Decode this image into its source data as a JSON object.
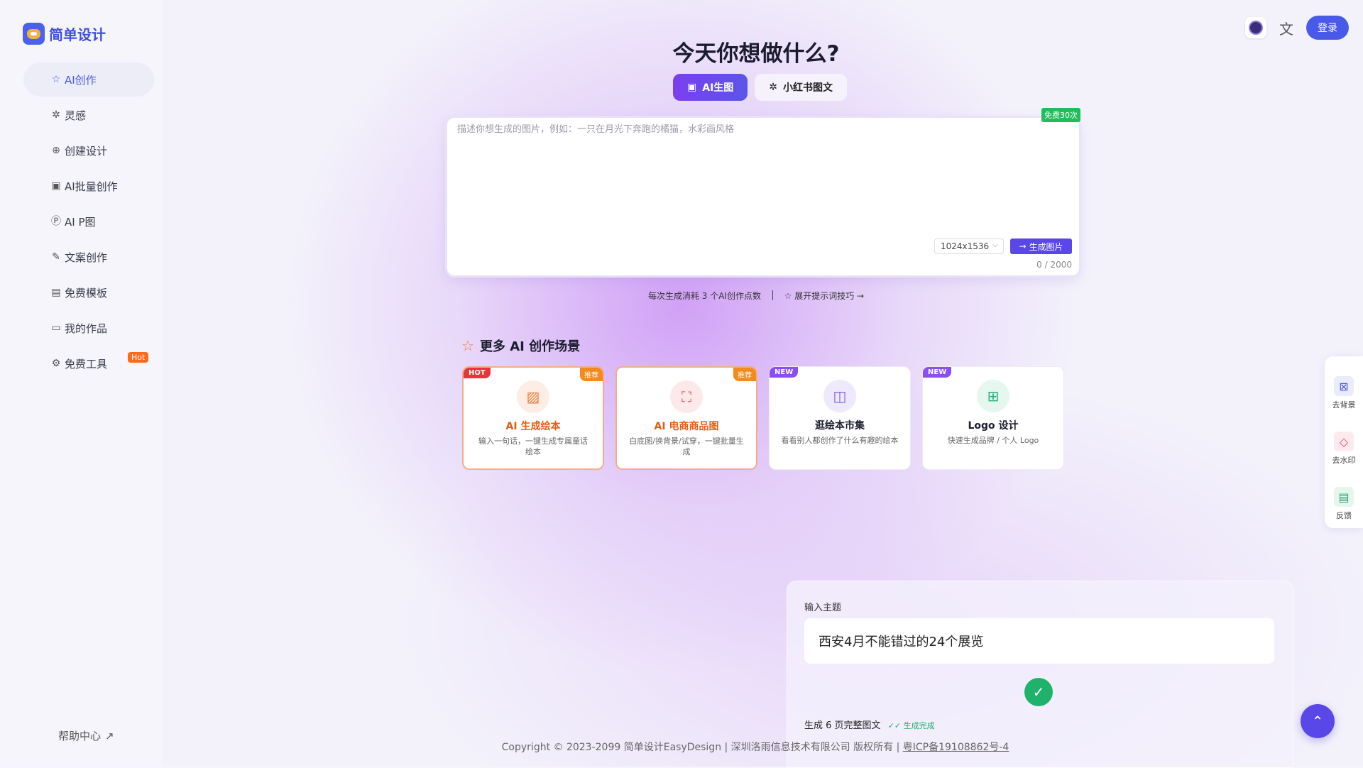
{
  "app": {
    "logo_text": "简单设计"
  },
  "sidebar": {
    "items": [
      {
        "label": "AI创作",
        "icon": "star-icon",
        "glyph": "☆"
      },
      {
        "label": "灵感",
        "icon": "sparkle-icon",
        "glyph": "✲"
      },
      {
        "label": "创建设计",
        "icon": "plus-circle-icon",
        "glyph": "⊕"
      },
      {
        "label": "AI批量创作",
        "icon": "image-icon",
        "glyph": "▣"
      },
      {
        "label": "AI P图",
        "icon": "ps-icon",
        "glyph": "Ⓟ"
      },
      {
        "label": "文案创作",
        "icon": "edit-icon",
        "glyph": "✎"
      },
      {
        "label": "免费模板",
        "icon": "template-icon",
        "glyph": "▤"
      },
      {
        "label": "我的作品",
        "icon": "folder-icon",
        "glyph": "▭"
      },
      {
        "label": "免费工具",
        "icon": "gear-icon",
        "glyph": "⚙",
        "badge": "Hot"
      }
    ],
    "help": "帮助中心"
  },
  "header": {
    "login": "登录"
  },
  "main": {
    "title": "今天你想做什么?",
    "tabs": [
      {
        "label": "AI生图",
        "icon": "image-icon"
      },
      {
        "label": "小红书图文",
        "icon": "sparkle-icon"
      }
    ],
    "prompt": {
      "placeholder": "描述你想生成的图片，例如：一只在月光下奔跑的橘猫，水彩画风格",
      "value": "",
      "free_badge": "免费30次",
      "size": "1024x1536",
      "generate": "生成图片",
      "counter": "0 / 2000"
    },
    "hint": {
      "cost": "每次生成消耗 3 个AI创作点数",
      "tips": "展开提示词技巧 →"
    },
    "scenes_title": "更多 AI 创作场景",
    "scenes": [
      {
        "tag": "HOT",
        "tag_color": "#e8343a",
        "corner": "推荐",
        "title": "AI 生成绘本",
        "desc": "输入一句话，一键生成专属童话绘本",
        "title_color": "#e85a12",
        "icon_glyph": "▨",
        "icon_bg": "#fdeee5",
        "icon_color": "#f07a3a"
      },
      {
        "tag": "",
        "tag_color": "",
        "corner": "推荐",
        "title": "AI 电商商品图",
        "desc": "白底图/换背景/试穿，一键批量生成",
        "title_color": "#e85a12",
        "icon_glyph": "⛶",
        "icon_bg": "#fde9ea",
        "icon_color": "#ea4a5a"
      },
      {
        "tag": "NEW",
        "tag_color": "#8a4ff0",
        "corner": "",
        "title": "逛绘本市集",
        "desc": "看看别人都创作了什么有趣的绘本",
        "title_color": "#1b1c2e",
        "icon_glyph": "◫",
        "icon_bg": "#eeeafc",
        "icon_color": "#7a5ae8"
      },
      {
        "tag": "NEW",
        "tag_color": "#8a4ff0",
        "corner": "",
        "title": "Logo 设计",
        "desc": "快速生成品牌 / 个人 Logo",
        "title_color": "#1b1c2e",
        "icon_glyph": "⊞",
        "icon_bg": "#e6f7ef",
        "icon_color": "#22b07a"
      }
    ]
  },
  "panel": {
    "label": "输入主题",
    "topic": "西安4月不能错过的24个展览",
    "status": "生成 6 页完整图文",
    "status_done": "✓✓ 生成完成"
  },
  "tools": [
    {
      "label": "去背景",
      "icon": "remove-bg-icon",
      "glyph": "⊠",
      "color": "#4a5ae8",
      "bg": "#eaecfd"
    },
    {
      "label": "去水印",
      "icon": "eraser-icon",
      "glyph": "◇",
      "color": "#ea4a6a",
      "bg": "#fde9ee"
    },
    {
      "label": "反馈",
      "icon": "chat-icon",
      "glyph": "▤",
      "color": "#22a06a",
      "bg": "#e6f6ee"
    }
  ],
  "footer": {
    "copyright": "Copyright © 2023-2099 简单设计EasyDesign | 深圳洛雨信息技术有限公司 版权所有 | ",
    "icp": "粤ICP备19108862号-4"
  }
}
